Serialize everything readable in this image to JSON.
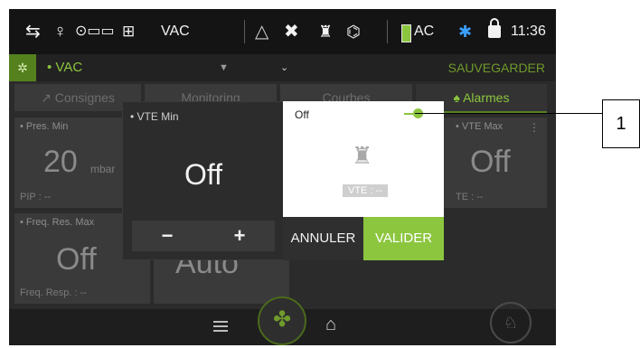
{
  "status_bar": {
    "mode": "VAC",
    "power": "AC",
    "time": "11:36",
    "icons": [
      "lungs-circuit-icon",
      "patient-icon",
      "circuit-icon",
      "humidifier-icon",
      "alarm-triangle-icon",
      "tools-icon",
      "robot-icon",
      "lungs-icon",
      "battery-icon",
      "bluetooth-icon",
      "unlock-icon"
    ]
  },
  "mode_row": {
    "mode_label": "VAC",
    "save_label": "SAUVEGARDER"
  },
  "tabs": [
    "Consignes",
    "Monitoring",
    "Courbes",
    "Alarmes"
  ],
  "cards": {
    "pres_min": {
      "label": "Pres. Min",
      "value": "20",
      "unit": "mbar",
      "sub": "PIP : --"
    },
    "vte_max": {
      "label": "VTE Max",
      "value": "Off",
      "sub": "TE : --"
    },
    "freq_max": {
      "label": "Freq. Res. Max",
      "value": "Off",
      "sub": "Freq. Resp. : --"
    },
    "auto_card": {
      "value": "Auto"
    }
  },
  "popup": {
    "title": "VTE Min",
    "value": "Off",
    "minus": "−",
    "plus": "+"
  },
  "dialog": {
    "toggle_label": "Off",
    "vte_readout": "VTE : --",
    "cancel": "ANNULER",
    "confirm": "VALIDER"
  },
  "callout": {
    "number": "1"
  },
  "colors": {
    "accent": "#8cc63f",
    "background": "#2b2b2b",
    "status_bar": "#141414"
  }
}
